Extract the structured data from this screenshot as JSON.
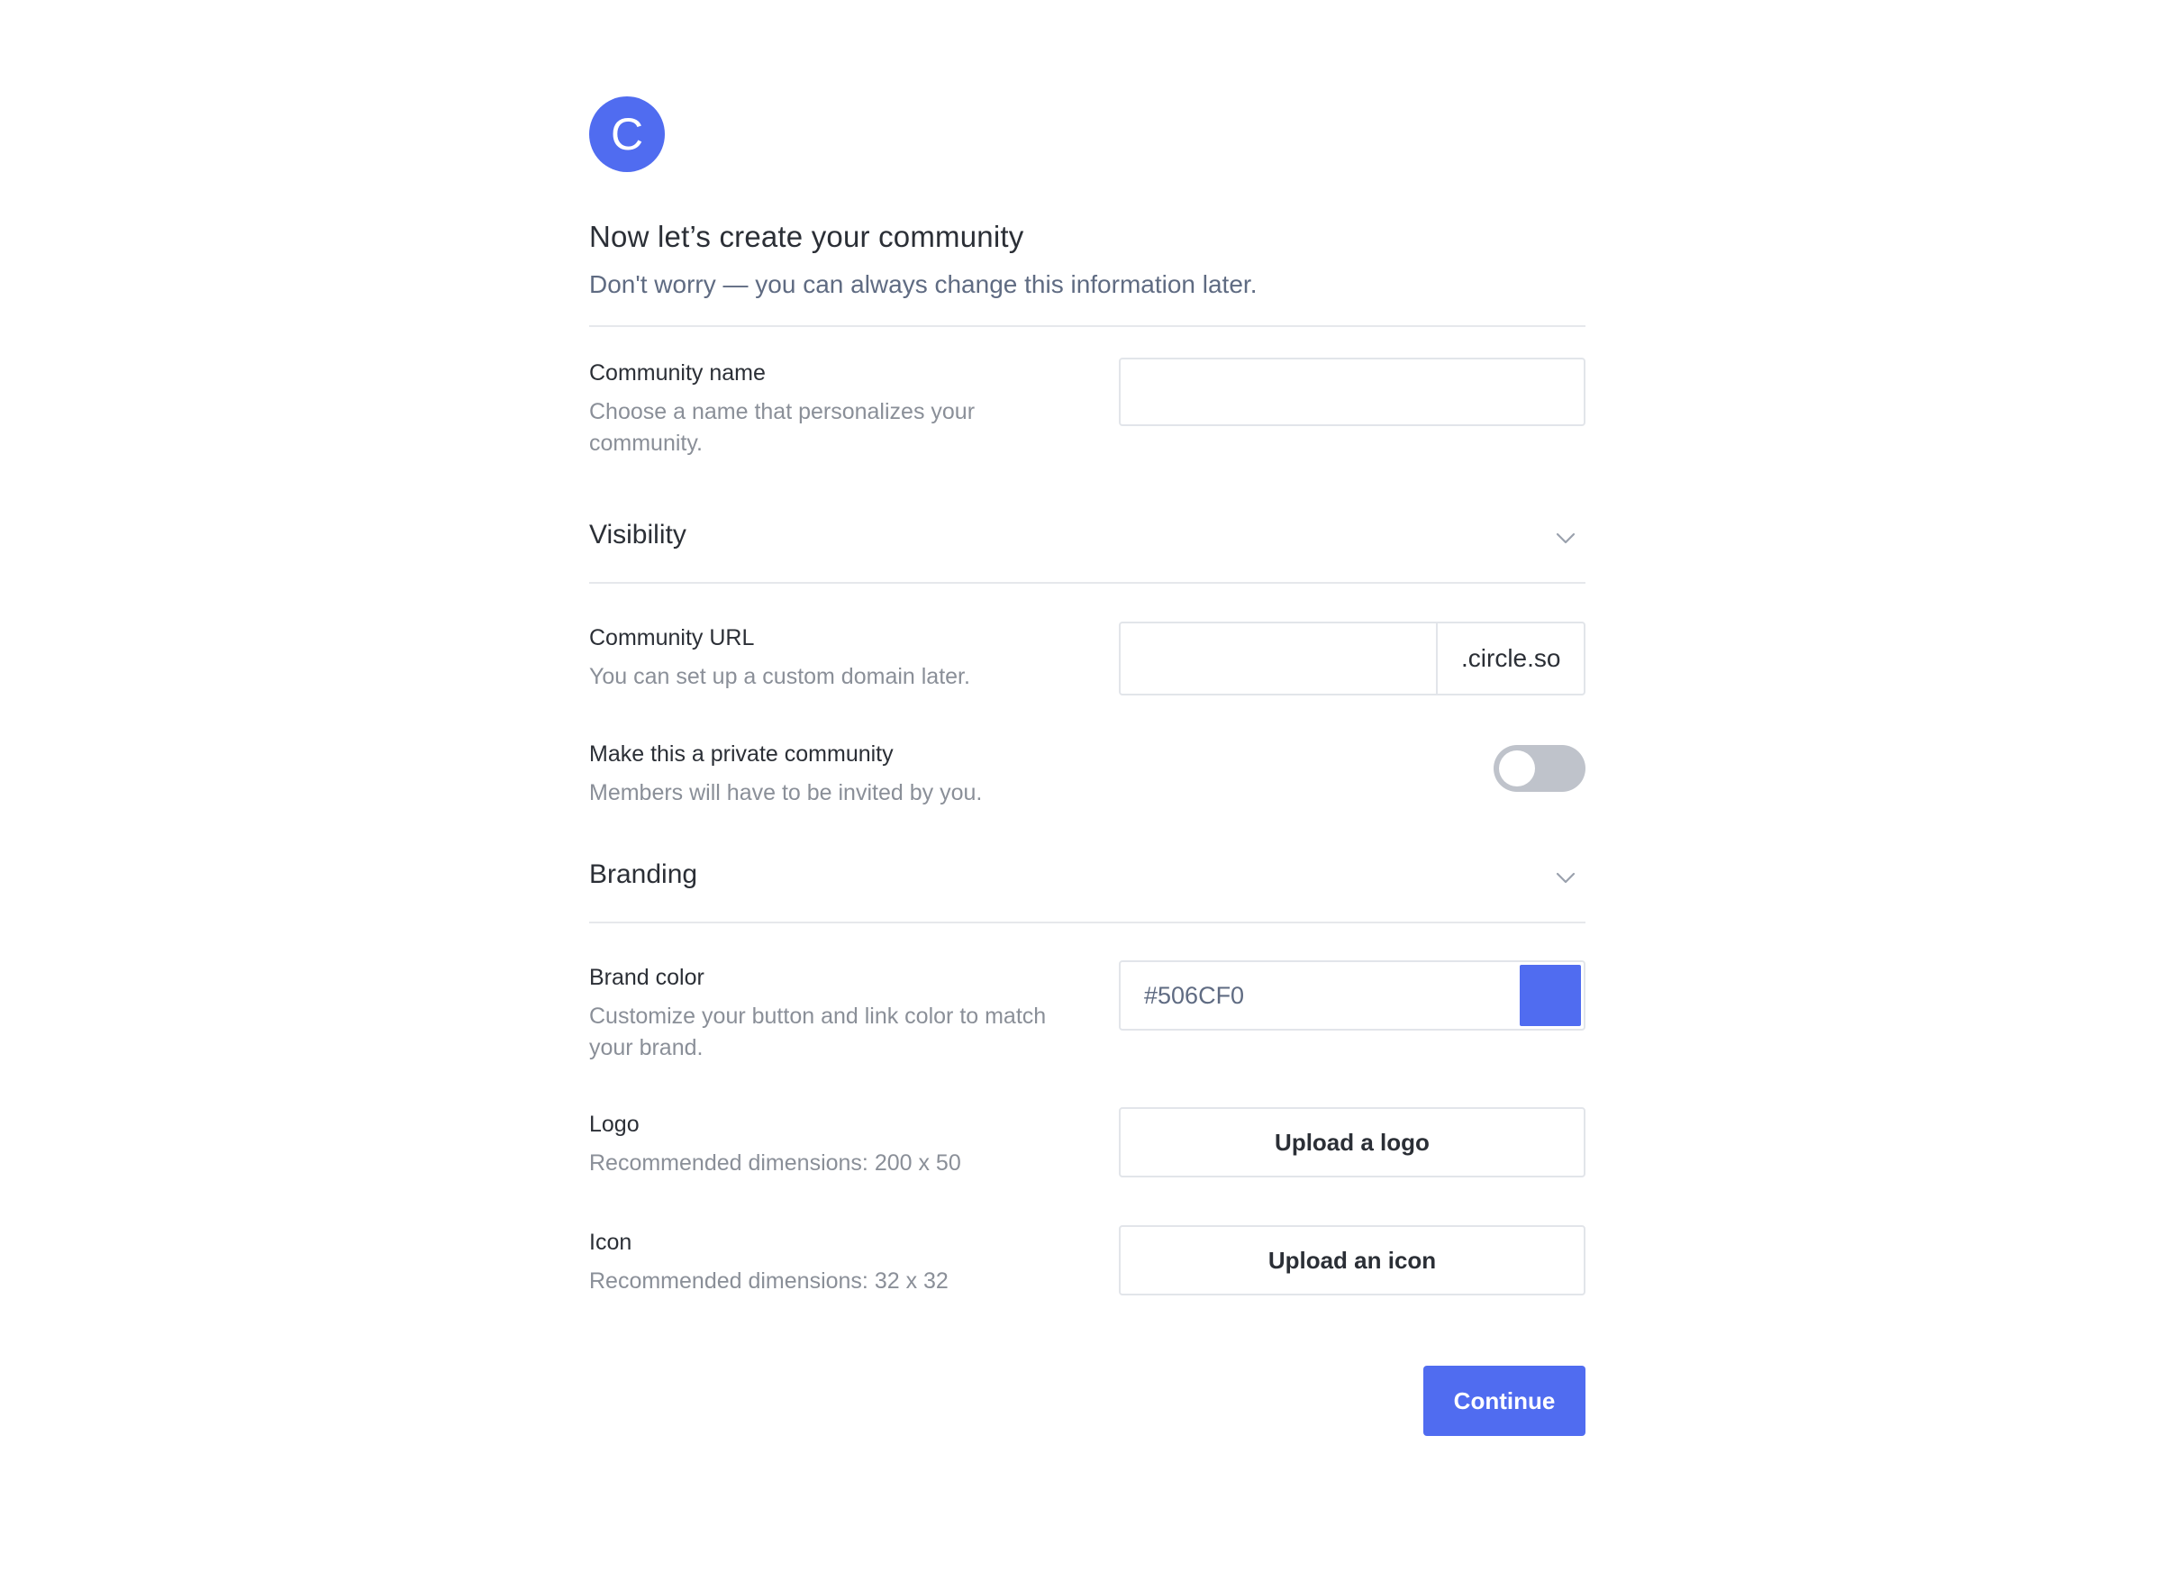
{
  "brand": {
    "logo_letter": "C",
    "accent_color": "#506CF0"
  },
  "header": {
    "title": "Now let’s create your community",
    "subtitle": "Don't worry — you can always change this information later."
  },
  "community_name": {
    "label": "Community name",
    "description": "Choose a name that personalizes your community.",
    "value": "",
    "placeholder": ""
  },
  "visibility": {
    "section_title": "Visibility",
    "chevron_icon": "chevron-down-icon",
    "url": {
      "label": "Community URL",
      "description": "You can set up a custom domain later.",
      "value": "",
      "suffix": ".circle.so"
    },
    "private": {
      "label": "Make this a private community",
      "description": "Members will have to be invited by you.",
      "enabled": false
    }
  },
  "branding": {
    "section_title": "Branding",
    "chevron_icon": "chevron-down-icon",
    "brand_color": {
      "label": "Brand color",
      "description": "Customize your button and link color to match your brand.",
      "value": "#506CF0",
      "swatch_color": "#506CF0"
    },
    "logo": {
      "label": "Logo",
      "description": "Recommended dimensions: 200 x 50",
      "button_label": "Upload a logo"
    },
    "icon": {
      "label": "Icon",
      "description": "Recommended dimensions: 32 x 32",
      "button_label": "Upload an icon"
    }
  },
  "actions": {
    "continue_label": "Continue"
  }
}
